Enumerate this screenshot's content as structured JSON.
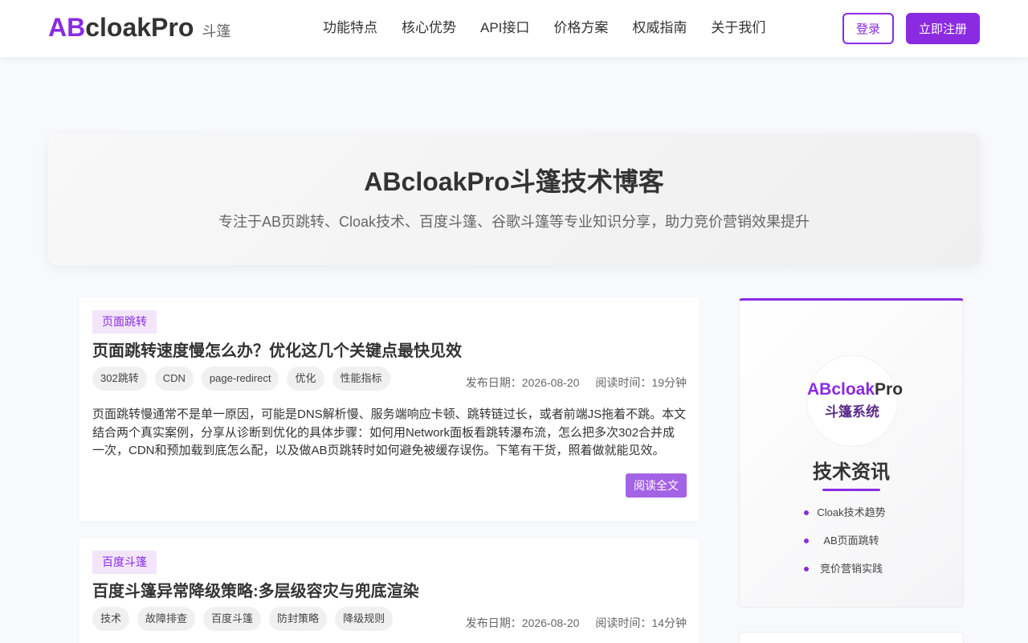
{
  "header": {
    "logo_ab": "AB",
    "logo_rest": "cloakPro",
    "logo_sub": "斗篷",
    "nav": [
      "功能特点",
      "核心优势",
      "API接口",
      "价格方案",
      "权威指南",
      "关于我们"
    ],
    "login_label": "登录",
    "register_label": "立即注册"
  },
  "hero": {
    "title": "ABcloakPro斗篷技术博客",
    "subtitle": "专注于AB页跳转、Cloak技术、百度斗篷、谷歌斗篷等专业知识分享，助力竞价营销效果提升"
  },
  "articles": [
    {
      "category": "页面跳转",
      "title": "页面跳转速度慢怎么办？优化这几个关键点最快见效",
      "tags": [
        "302跳转",
        "CDN",
        "page-redirect",
        "优化",
        "性能指标"
      ],
      "date_label": "发布日期：2026-08-20",
      "read_time_label": "阅读时间：19分钟",
      "summary": "页面跳转慢通常不是单一原因，可能是DNS解析慢、服务端响应卡顿、跳转链过长，或者前端JS拖着不跳。本文结合两个真实案例，分享从诊断到优化的具体步骤：如何用Network面板看跳转瀑布流，怎么把多次302合并成一次，CDN和预加载到底怎么配，以及做AB页跳转时如何避免被缓存误伤。下笔有干货，照着做就能见效。",
      "read_more": "阅读全文"
    },
    {
      "category": "百度斗篷",
      "title": "百度斗篷异常降级策略:多层级容灾与兜底渲染",
      "tags": [
        "技术",
        "故障排查",
        "百度斗篷",
        "防封策略",
        "降级规则"
      ],
      "date_label": "发布日期：2026-08-20",
      "read_time_label": "阅读时间：14分钟"
    }
  ],
  "sidebar": {
    "brand_ab": "ABcloak",
    "brand_pro": "Pro",
    "brand_sub": "斗篷系统",
    "title": "技术资讯",
    "items": [
      "Cloak技术趋势",
      "AB页面跳转",
      "竞价营销实践"
    ]
  },
  "colors": {
    "accent": "#8a2be2",
    "accent_light": "#a463e5",
    "category_bg": "#f3e6fb"
  }
}
